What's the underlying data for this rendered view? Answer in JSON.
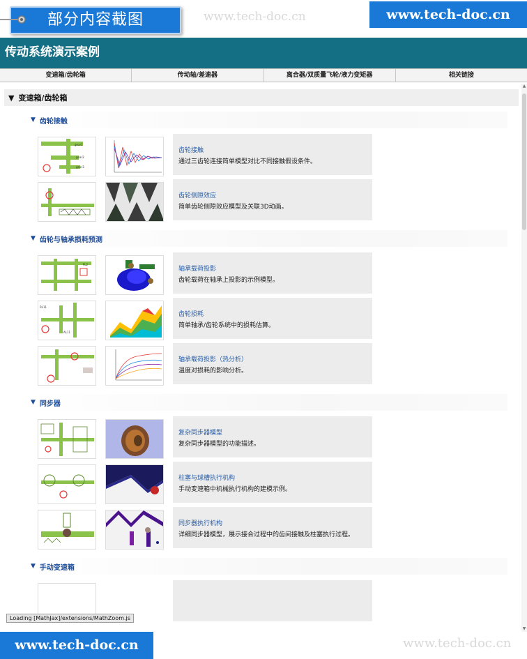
{
  "overlay": {
    "snip_label": "部分内容截图",
    "watermark_top": "www.tech-doc.cn",
    "brand_top": "www.tech-doc.cn",
    "brand_bottom": "www.tech-doc.cn",
    "watermark_bottom": "www.tech-doc.cn"
  },
  "app": {
    "title": "传动系统演示案例",
    "nav_tabs": [
      {
        "label": "变速箱/齿轮箱"
      },
      {
        "label": "传动轴/差速器"
      },
      {
        "label": "离合器/双质量飞轮/液力变矩器"
      },
      {
        "label": "相关链接"
      }
    ],
    "section": {
      "title": "变速箱/齿轮箱"
    },
    "groups": [
      {
        "title": "齿轮接触",
        "items": [
          {
            "title": "齿轮接触",
            "desc": "通过三齿轮连接简单模型对比不同接触假设条件。"
          },
          {
            "title": "齿轮侧隙效应",
            "desc": "简单齿轮侧隙效应模型及关联3D动画。"
          }
        ]
      },
      {
        "title": "齿轮与轴承损耗预测",
        "items": [
          {
            "title": "轴承载荷投影",
            "desc": "齿轮载荷在轴承上投影的示例模型。"
          },
          {
            "title": "齿轮损耗",
            "desc": "简单轴承/齿轮系统中的损耗估算。"
          },
          {
            "title": "轴承载荷投影（热分析）",
            "desc": "温度对损耗的影响分析。"
          }
        ]
      },
      {
        "title": "同步器",
        "items": [
          {
            "title": "复杂同步器模型",
            "desc": "复杂同步器模型的功能描述。"
          },
          {
            "title": "柱塞与球槽执行机构",
            "desc": "手动变速箱中机械执行机构的建模示例。"
          },
          {
            "title": "同步器执行机构",
            "desc": "详细同步器模型，展示接合过程中的齿间接触及柱塞执行过程。"
          }
        ]
      },
      {
        "title": "手动变速箱",
        "items": []
      }
    ],
    "status": "Loading [MathJax]/extensions/MathZoom.js"
  }
}
